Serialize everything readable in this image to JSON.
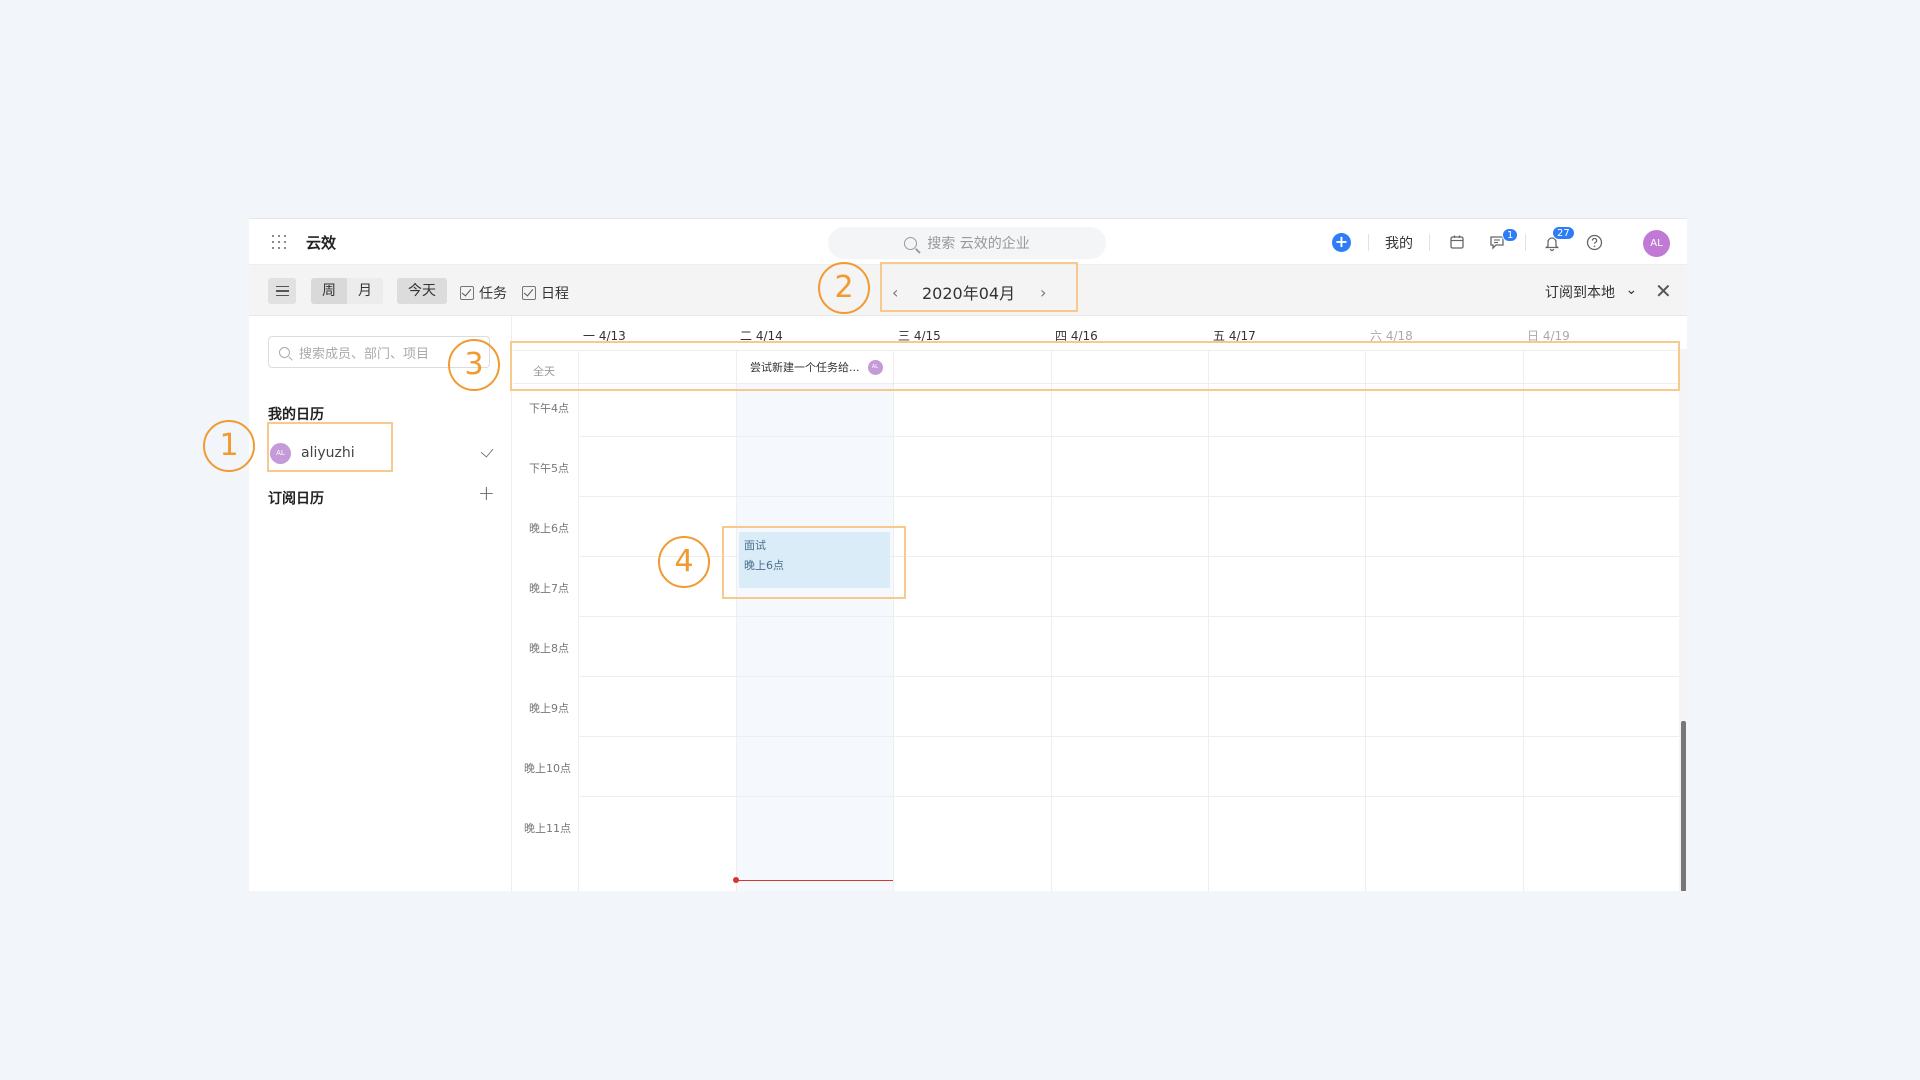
{
  "topbar": {
    "app_name": "云效",
    "search_placeholder": "搜索 云效的企业",
    "add_label": "+",
    "mine_label": "我的",
    "message_badge": "1",
    "notification_badge": "27",
    "avatar_initials": "AL"
  },
  "toolbar": {
    "view_week": "周",
    "view_month": "月",
    "today": "今天",
    "filter_task": "任务",
    "filter_schedule": "日程",
    "prev": "‹",
    "next": "›",
    "current_month": "2020年04月",
    "subscribe_local": "订阅到本地",
    "subscribe_chevron": "⌄",
    "close": "✕"
  },
  "sidebar": {
    "search_placeholder": "搜索成员、部门、项目",
    "my_calendar_title": "我的日历",
    "my_calendars": [
      {
        "avatar": "AL",
        "name": "aliyuzhi",
        "checked": true
      }
    ],
    "subscribed_title": "订阅日历",
    "add_label": "+"
  },
  "calendar": {
    "days": [
      {
        "label": "一 4/13",
        "weekend": false
      },
      {
        "label": "二 4/14",
        "weekend": false,
        "today": true
      },
      {
        "label": "三 4/15",
        "weekend": false
      },
      {
        "label": "四 4/16",
        "weekend": false
      },
      {
        "label": "五 4/17",
        "weekend": false
      },
      {
        "label": "六 4/18",
        "weekend": true
      },
      {
        "label": "日 4/19",
        "weekend": true
      }
    ],
    "allday_label": "全天",
    "allday_event": {
      "title": "尝试新建一个任务给...",
      "avatar": "AL"
    },
    "hours": [
      "下午4点",
      "下午5点",
      "晚上6点",
      "晚上7点",
      "晚上8点",
      "晚上9点",
      "晚上10点",
      "晚上11点"
    ],
    "event": {
      "title": "面试",
      "time": "晚上6点"
    }
  },
  "annotations": [
    "1",
    "2",
    "3",
    "4"
  ],
  "colors": {
    "accent": "#2e7cf6",
    "annotation": "#f09a30",
    "annotation_box": "#f8c98d",
    "event_bg": "#d9ecf7",
    "now_line": "#d9362b"
  }
}
